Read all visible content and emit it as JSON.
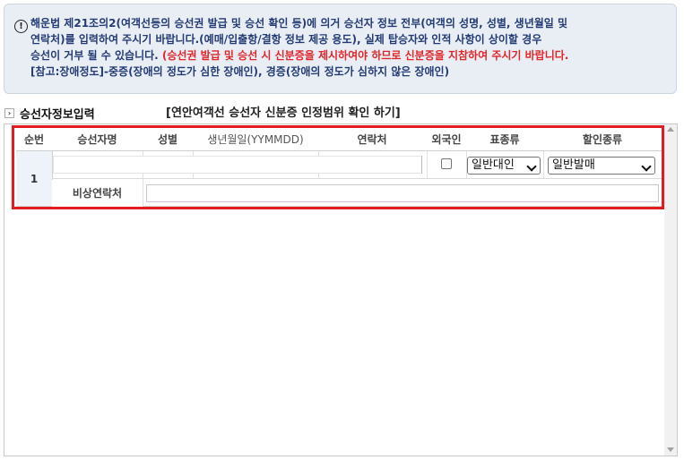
{
  "notice": {
    "line1": "해운법 제21조의2(여객선등의 승선권 발급 및 승선 확인 등)에 의거 승선자 정보 전부(여객의 성명, 성별, 생년월일 및",
    "line2": "연락처)를 입력하여 주시기 바랍니다.(예매/입출항/결항 정보 제공 용도), 실제 탑승자와 인적 사항이 상이할 경우",
    "line3a": "승선이 거부 될 수 있습니다. ",
    "line3b": "(승선권 발급 및 승선 시 신분증을 제시하여야 하므로 신분증을 지참하여 주시기 바랍니다.",
    "line4": "[참고:장애정도]-중증(장애의 정도가 심한 장애인), 경증(장애의 정도가 심하지 않은 장애인)",
    "icon": "exclamation-circle-icon",
    "colors": {
      "text": "#233a74",
      "warning": "#e0262a",
      "background": "#e9eef4"
    }
  },
  "section": {
    "tab_label": "승선자정보입력",
    "id_check_link": "[연안여객선 승선자 신분증 인정범위 확인 하기]"
  },
  "table": {
    "headers": {
      "seq": "순번",
      "name": "승선자명",
      "gender": "성별",
      "birth": "생년월일(YYMMDD)",
      "contact": "연락처",
      "foreigner": "외국인",
      "ticket_type": "표종류",
      "discount_type": "할인종류"
    },
    "rows": [
      {
        "seq": "1",
        "name": "",
        "gender": "",
        "birth": "",
        "contact": "",
        "foreigner": false,
        "ticket_type": "일반대인",
        "discount_type": "일반발매",
        "emergency_label": "비상연락처",
        "emergency_contact": ""
      }
    ]
  },
  "highlight_color": "#e31b23"
}
